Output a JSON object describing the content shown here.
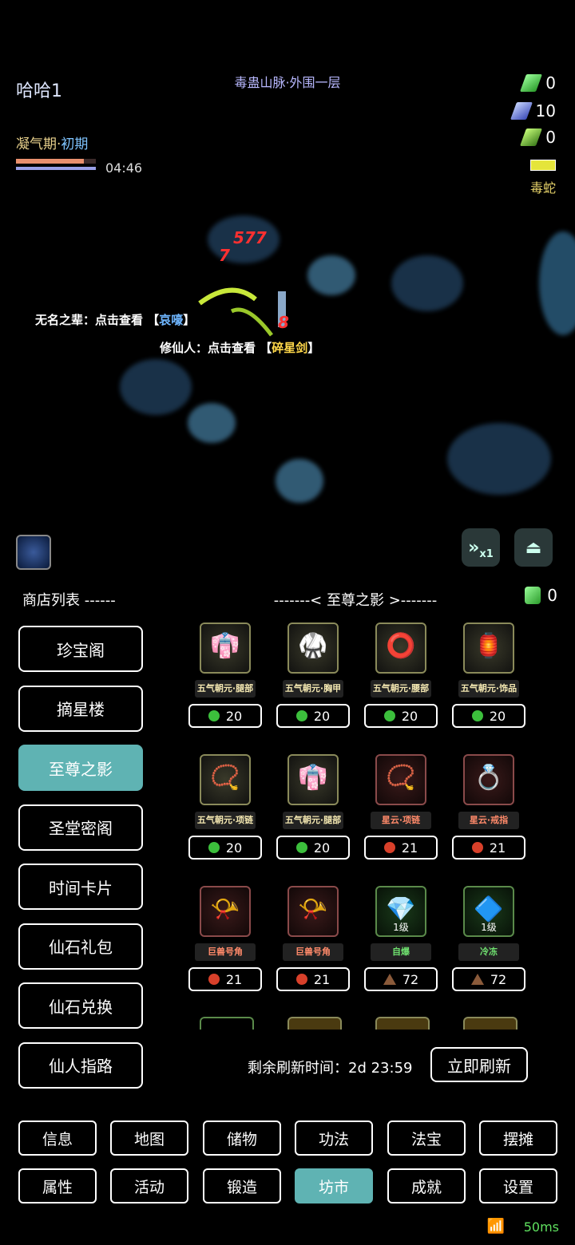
{
  "hud": {
    "player_name": "哈哈1",
    "map_name": "毒蛊山脉·外围一层",
    "realm_stage": "凝气期",
    "realm_sep": "·",
    "realm_sub": "初期",
    "timer": "04:46",
    "hp_fraction": 0.85,
    "mp_fraction": 1.0,
    "resources": [
      {
        "icon": "green-gem-icon",
        "color": "#4fcf4f",
        "value": "0"
      },
      {
        "icon": "blue-gem-icon",
        "color": "#6a88e8",
        "value": "10"
      },
      {
        "icon": "green-crystal-icon",
        "color": "#6fbf3a",
        "value": "0"
      }
    ],
    "enemy_name": "毒蛇"
  },
  "battle": {
    "damage": [
      "577",
      "7",
      "8"
    ],
    "chat": [
      {
        "speaker": "无名之辈：",
        "action": "点击查看",
        "bracket_l": "【",
        "tag": "哀嚎",
        "bracket_r": "】"
      },
      {
        "speaker": "修仙人：",
        "action": "点击查看",
        "bracket_l": "【",
        "tag": "碎星剑",
        "bracket_r": "】"
      }
    ]
  },
  "controls": {
    "speed_label": "x1"
  },
  "shop": {
    "list_title": "商店列表 ------",
    "title": "-------< 至尊之影 >-------",
    "currency_value": "0",
    "shops": [
      "珍宝阁",
      "摘星楼",
      "至尊之影",
      "圣堂密阁",
      "时间卡片",
      "仙石礼包",
      "仙石兑换",
      "仙人指路"
    ],
    "active_shop": 2,
    "items": [
      {
        "name": "五气朝元·腿部",
        "name_color": "#f2e6b0",
        "frame": "gold",
        "glyph": "👘",
        "price": "20",
        "coin": "green",
        "level": ""
      },
      {
        "name": "五气朝元·胸甲",
        "name_color": "#f2e6b0",
        "frame": "gold",
        "glyph": "🥋",
        "price": "20",
        "coin": "green",
        "level": ""
      },
      {
        "name": "五气朝元·腰部",
        "name_color": "#f2e6b0",
        "frame": "gold",
        "glyph": "⭕",
        "price": "20",
        "coin": "green",
        "level": ""
      },
      {
        "name": "五气朝元·饰品",
        "name_color": "#f2e6b0",
        "frame": "gold",
        "glyph": "🏮",
        "price": "20",
        "coin": "green",
        "level": ""
      },
      {
        "name": "五气朝元·项链",
        "name_color": "#f2e6b0",
        "frame": "gold",
        "glyph": "📿",
        "price": "20",
        "coin": "green",
        "level": ""
      },
      {
        "name": "五气朝元·腿部",
        "name_color": "#f2e6b0",
        "frame": "gold",
        "glyph": "👘",
        "price": "20",
        "coin": "green",
        "level": ""
      },
      {
        "name": "星云·项链",
        "name_color": "#ff8a6a",
        "frame": "red",
        "glyph": "📿",
        "price": "21",
        "coin": "red",
        "level": ""
      },
      {
        "name": "星云·戒指",
        "name_color": "#ff8a6a",
        "frame": "red",
        "glyph": "💍",
        "price": "21",
        "coin": "red",
        "level": ""
      },
      {
        "name": "巨兽号角",
        "name_color": "#ff8a6a",
        "frame": "red",
        "glyph": "📯",
        "price": "21",
        "coin": "red",
        "level": ""
      },
      {
        "name": "巨兽号角",
        "name_color": "#ff8a6a",
        "frame": "red",
        "glyph": "📯",
        "price": "21",
        "coin": "red",
        "level": ""
      },
      {
        "name": "自爆",
        "name_color": "#6fe06f",
        "frame": "green",
        "glyph": "💎",
        "price": "72",
        "coin": "brown",
        "level": "1级"
      },
      {
        "name": "冷冻",
        "name_color": "#6fe06f",
        "frame": "green",
        "glyph": "🔷",
        "price": "72",
        "coin": "brown",
        "level": "1级"
      }
    ],
    "refresh_label": "剩余刷新时间：2d 23:59",
    "refresh_button": "立即刷新"
  },
  "nav": {
    "row1": [
      "信息",
      "地图",
      "储物",
      "功法",
      "法宝",
      "摆摊"
    ],
    "row2": [
      "属性",
      "活动",
      "锻造",
      "坊市",
      "成就",
      "设置"
    ],
    "active": "坊市"
  },
  "status": {
    "ping": "50ms"
  }
}
